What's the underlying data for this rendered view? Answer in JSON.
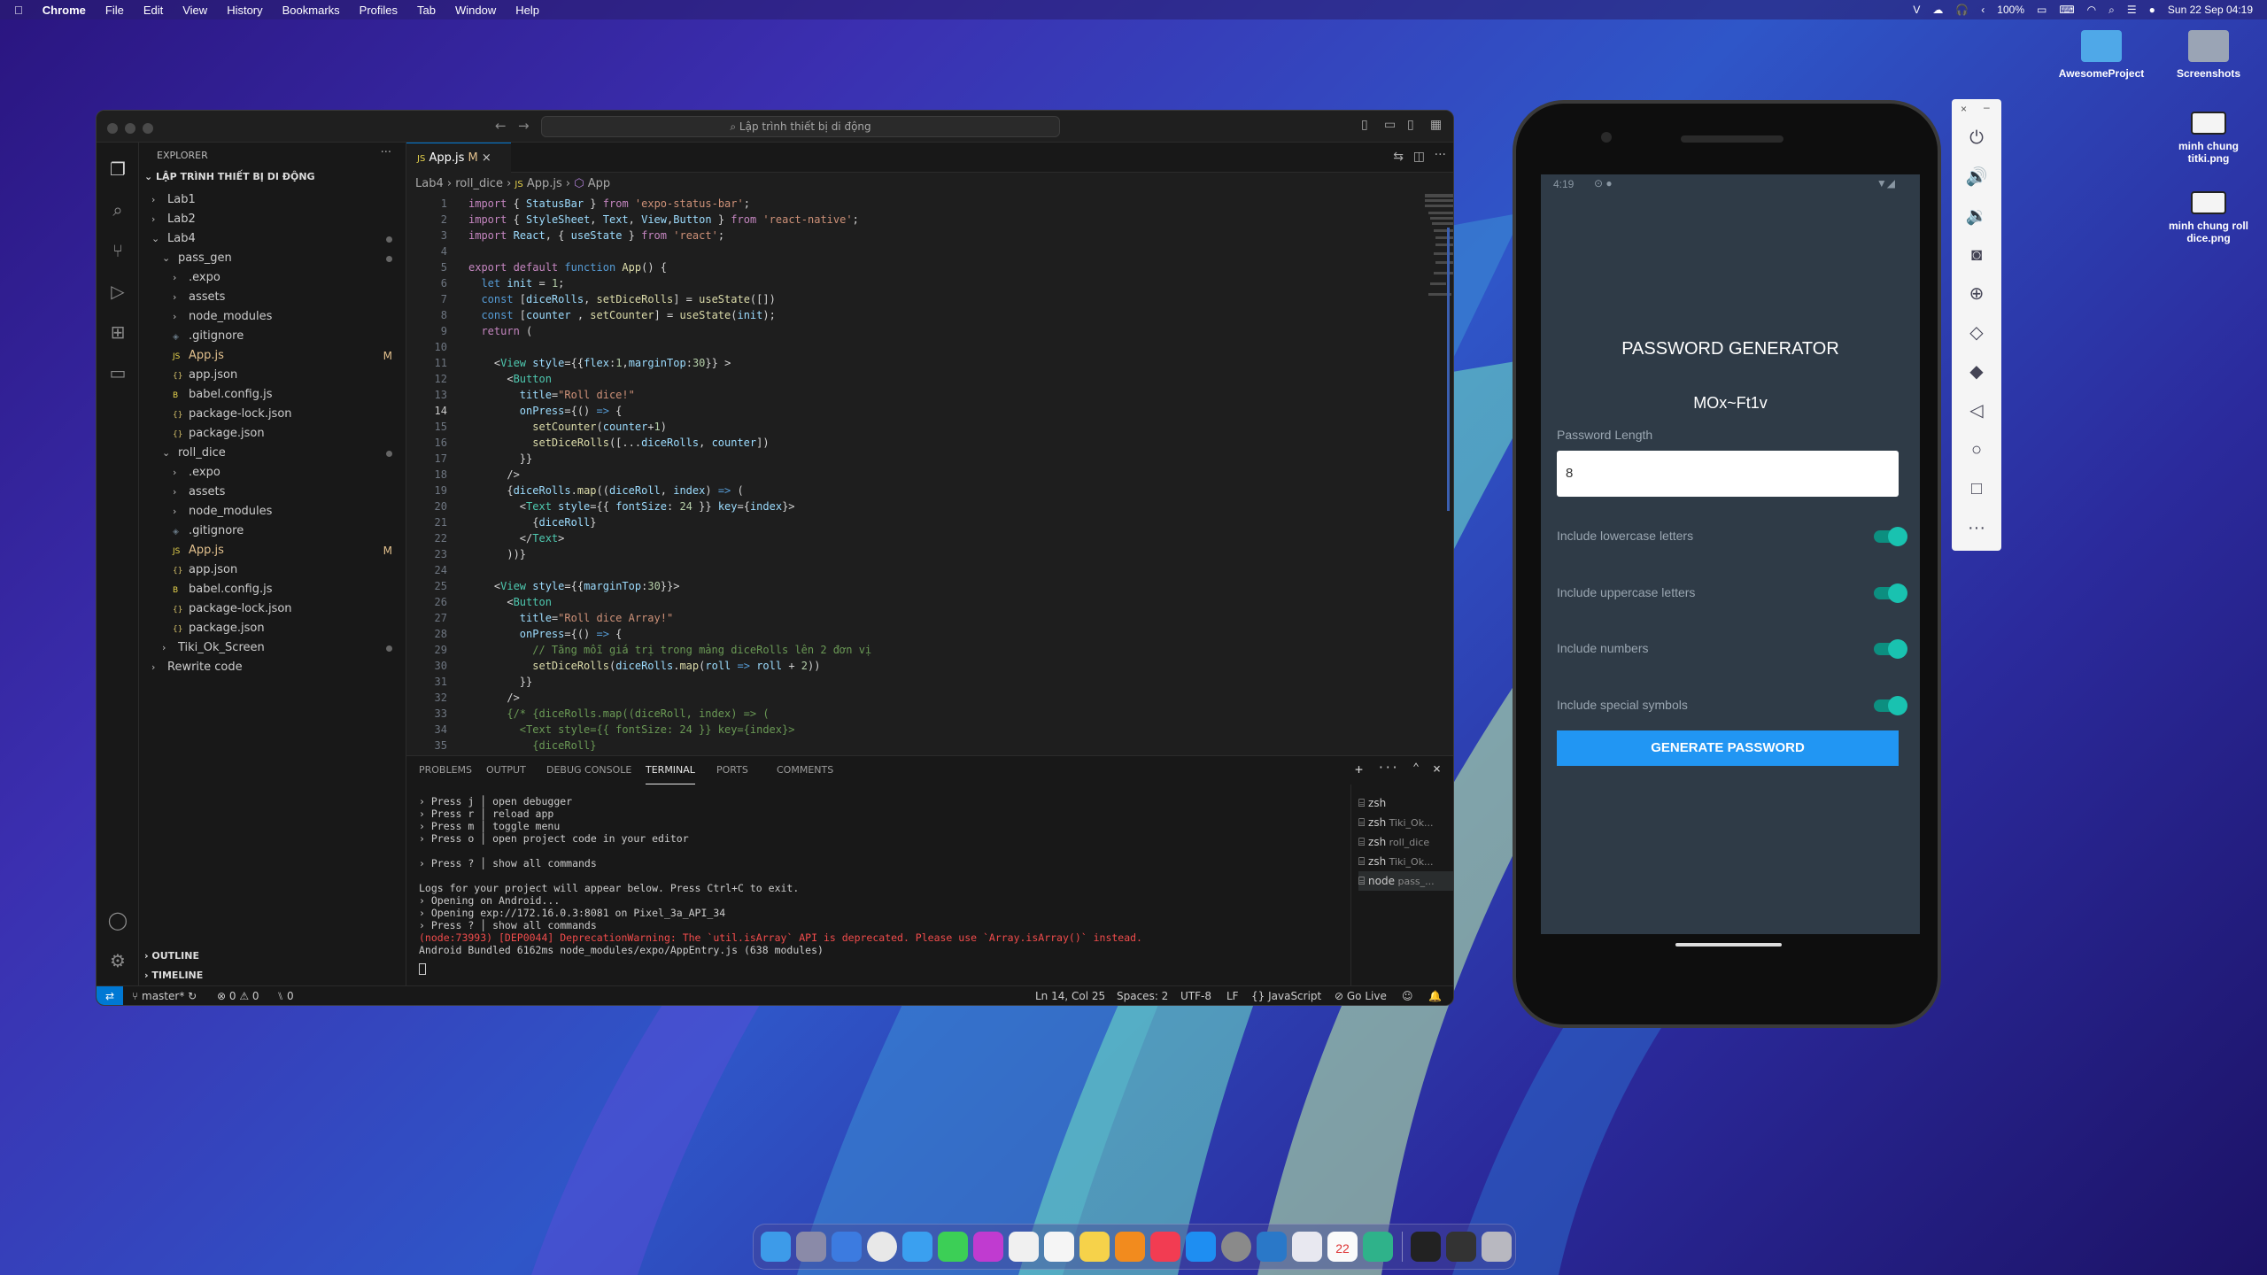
{
  "menubar": {
    "app": "Chrome",
    "items": [
      "File",
      "Edit",
      "View",
      "History",
      "Bookmarks",
      "Profiles",
      "Tab",
      "Window",
      "Help"
    ],
    "battery": "100%",
    "datetime": "Sun 22 Sep  04:19"
  },
  "desktop": {
    "icons": [
      {
        "label": "AwesomeProject"
      },
      {
        "label": "Screenshots"
      },
      {
        "label": "minh chung titki.png"
      },
      {
        "label": "minh chung roll dice.png"
      }
    ]
  },
  "vscode": {
    "search": "Lập trình thiết bị di động",
    "explorer_title": "EXPLORER",
    "workspace": "LẬP TRÌNH THIẾT BỊ DI ĐỘNG",
    "tree": [
      {
        "label": "Lab1",
        "depth": 0,
        "kind": "folder",
        "open": false
      },
      {
        "label": "Lab2",
        "depth": 0,
        "kind": "folder",
        "open": false
      },
      {
        "label": "Lab4",
        "depth": 0,
        "kind": "folder",
        "open": true,
        "dot": true
      },
      {
        "label": "pass_gen",
        "depth": 1,
        "kind": "folder",
        "open": true,
        "dot": true
      },
      {
        "label": ".expo",
        "depth": 2,
        "kind": "folder",
        "open": false
      },
      {
        "label": "assets",
        "depth": 2,
        "kind": "folder",
        "open": false
      },
      {
        "label": "node_modules",
        "depth": 2,
        "kind": "folder",
        "open": false
      },
      {
        "label": ".gitignore",
        "depth": 2,
        "kind": "file",
        "icon": "◈"
      },
      {
        "label": "App.js",
        "depth": 2,
        "kind": "file",
        "icon": "JS",
        "mod": "M"
      },
      {
        "label": "app.json",
        "depth": 2,
        "kind": "file",
        "icon": "{}"
      },
      {
        "label": "babel.config.js",
        "depth": 2,
        "kind": "file",
        "icon": "B"
      },
      {
        "label": "package-lock.json",
        "depth": 2,
        "kind": "file",
        "icon": "{}"
      },
      {
        "label": "package.json",
        "depth": 2,
        "kind": "file",
        "icon": "{}"
      },
      {
        "label": "roll_dice",
        "depth": 1,
        "kind": "folder",
        "open": true,
        "dot": true
      },
      {
        "label": ".expo",
        "depth": 2,
        "kind": "folder",
        "open": false
      },
      {
        "label": "assets",
        "depth": 2,
        "kind": "folder",
        "open": false
      },
      {
        "label": "node_modules",
        "depth": 2,
        "kind": "folder",
        "open": false
      },
      {
        "label": ".gitignore",
        "depth": 2,
        "kind": "file",
        "icon": "◈"
      },
      {
        "label": "App.js",
        "depth": 2,
        "kind": "file",
        "icon": "JS",
        "mod": "M"
      },
      {
        "label": "app.json",
        "depth": 2,
        "kind": "file",
        "icon": "{}"
      },
      {
        "label": "babel.config.js",
        "depth": 2,
        "kind": "file",
        "icon": "B"
      },
      {
        "label": "package-lock.json",
        "depth": 2,
        "kind": "file",
        "icon": "{}"
      },
      {
        "label": "package.json",
        "depth": 2,
        "kind": "file",
        "icon": "{}"
      },
      {
        "label": "Tiki_Ok_Screen",
        "depth": 1,
        "kind": "folder",
        "open": false,
        "dot": true
      },
      {
        "label": "Rewrite code",
        "depth": 0,
        "kind": "folder",
        "open": false
      }
    ],
    "outline": "OUTLINE",
    "timeline": "TIMELINE",
    "tab": {
      "label": "App.js",
      "mod": "M"
    },
    "breadcrumb": [
      "Lab4",
      "roll_dice",
      "App.js",
      "App"
    ],
    "code": [
      [
        [
          "k",
          "import"
        ],
        [
          "p",
          " { "
        ],
        [
          "v",
          "StatusBar"
        ],
        [
          "p",
          " } "
        ],
        [
          "k",
          "from"
        ],
        [
          "s",
          " 'expo-status-bar'"
        ],
        [
          "p",
          ";"
        ]
      ],
      [
        [
          "k",
          "import"
        ],
        [
          "p",
          " { "
        ],
        [
          "v",
          "StyleSheet"
        ],
        [
          "p",
          ", "
        ],
        [
          "v",
          "Text"
        ],
        [
          "p",
          ", "
        ],
        [
          "v",
          "View"
        ],
        [
          "p",
          ","
        ],
        [
          "v",
          "Button"
        ],
        [
          "p",
          " } "
        ],
        [
          "k",
          "from"
        ],
        [
          "s",
          " 'react-native'"
        ],
        [
          "p",
          ";"
        ]
      ],
      [
        [
          "k",
          "import"
        ],
        [
          "p",
          " "
        ],
        [
          "v",
          "React"
        ],
        [
          "p",
          ", { "
        ],
        [
          "v",
          "useState"
        ],
        [
          "p",
          " } "
        ],
        [
          "k",
          "from"
        ],
        [
          "s",
          " 'react'"
        ],
        [
          "p",
          ";"
        ]
      ],
      [],
      [
        [
          "k",
          "export default"
        ],
        [
          "b",
          " function"
        ],
        [
          "f",
          " App"
        ],
        [
          "p",
          "() {"
        ]
      ],
      [
        [
          "b",
          "  let"
        ],
        [
          "v",
          " init"
        ],
        [
          "p",
          " = "
        ],
        [
          "n",
          "1"
        ],
        [
          "p",
          ";"
        ]
      ],
      [
        [
          "b",
          "  const"
        ],
        [
          "p",
          " ["
        ],
        [
          "v",
          "diceRolls"
        ],
        [
          "p",
          ", "
        ],
        [
          "f",
          "setDiceRolls"
        ],
        [
          "p",
          "] = "
        ],
        [
          "f",
          "useState"
        ],
        [
          "p",
          "([])"
        ]
      ],
      [
        [
          "b",
          "  const"
        ],
        [
          "p",
          " ["
        ],
        [
          "v",
          "counter"
        ],
        [
          "p",
          " , "
        ],
        [
          "f",
          "setCounter"
        ],
        [
          "p",
          "] = "
        ],
        [
          "f",
          "useState"
        ],
        [
          "p",
          "("
        ],
        [
          "v",
          "init"
        ],
        [
          "p",
          ");"
        ]
      ],
      [
        [
          "k",
          "  return"
        ],
        [
          "p",
          " ("
        ]
      ],
      [],
      [
        [
          "p",
          "    <"
        ],
        [
          "t",
          "View"
        ],
        [
          "v",
          " style"
        ],
        [
          "p",
          "={{"
        ],
        [
          "v",
          "flex"
        ],
        [
          "p",
          ":"
        ],
        [
          "n",
          "1"
        ],
        [
          "p",
          ","
        ],
        [
          "v",
          "marginTop"
        ],
        [
          "p",
          ":"
        ],
        [
          "n",
          "30"
        ],
        [
          "p",
          "}} >"
        ]
      ],
      [
        [
          "p",
          "      <"
        ],
        [
          "t",
          "Button"
        ]
      ],
      [
        [
          "v",
          "        title"
        ],
        [
          "p",
          "="
        ],
        [
          "s",
          "\"Roll dice!\""
        ]
      ],
      [
        [
          "v",
          "        onPress"
        ],
        [
          "p",
          "={() "
        ],
        [
          "b",
          "=>"
        ],
        [
          "p",
          " {"
        ]
      ],
      [
        [
          "f",
          "          setCounter"
        ],
        [
          "p",
          "("
        ],
        [
          "v",
          "counter"
        ],
        [
          "p",
          "+"
        ],
        [
          "n",
          "1"
        ],
        [
          "p",
          ")"
        ]
      ],
      [
        [
          "f",
          "          setDiceRolls"
        ],
        [
          "p",
          "([..."
        ],
        [
          "v",
          "diceRolls"
        ],
        [
          "p",
          ", "
        ],
        [
          "v",
          "counter"
        ],
        [
          "p",
          "])"
        ]
      ],
      [
        [
          "p",
          "        }}"
        ]
      ],
      [
        [
          "p",
          "      />"
        ]
      ],
      [
        [
          "p",
          "      {"
        ],
        [
          "v",
          "diceRolls"
        ],
        [
          "p",
          "."
        ],
        [
          "f",
          "map"
        ],
        [
          "p",
          "(("
        ],
        [
          "v",
          "diceRoll"
        ],
        [
          "p",
          ", "
        ],
        [
          "v",
          "index"
        ],
        [
          "p",
          ") "
        ],
        [
          "b",
          "=>"
        ],
        [
          "p",
          " ("
        ]
      ],
      [
        [
          "p",
          "        <"
        ],
        [
          "t",
          "Text"
        ],
        [
          "v",
          " style"
        ],
        [
          "p",
          "={{ "
        ],
        [
          "v",
          "fontSize"
        ],
        [
          "p",
          ": "
        ],
        [
          "n",
          "24"
        ],
        [
          "p",
          " }} "
        ],
        [
          "v",
          "key"
        ],
        [
          "p",
          "={"
        ],
        [
          "v",
          "index"
        ],
        [
          "p",
          "}>"
        ]
      ],
      [
        [
          "p",
          "          {"
        ],
        [
          "v",
          "diceRoll"
        ],
        [
          "p",
          "}"
        ]
      ],
      [
        [
          "p",
          "        </"
        ],
        [
          "t",
          "Text"
        ],
        [
          "p",
          ">"
        ]
      ],
      [
        [
          "p",
          "      ))}"
        ]
      ],
      [],
      [
        [
          "p",
          "    <"
        ],
        [
          "t",
          "View"
        ],
        [
          "v",
          " style"
        ],
        [
          "p",
          "={{"
        ],
        [
          "v",
          "marginTop"
        ],
        [
          "p",
          ":"
        ],
        [
          "n",
          "30"
        ],
        [
          "p",
          "}}>"
        ]
      ],
      [
        [
          "p",
          "      <"
        ],
        [
          "t",
          "Button"
        ]
      ],
      [
        [
          "v",
          "        title"
        ],
        [
          "p",
          "="
        ],
        [
          "s",
          "\"Roll dice Array!\""
        ]
      ],
      [
        [
          "v",
          "        onPress"
        ],
        [
          "p",
          "={() "
        ],
        [
          "b",
          "=>"
        ],
        [
          "p",
          " {"
        ]
      ],
      [
        [
          "c",
          "          // Tăng mỗi giá trị trong mảng diceRolls lên 2 đơn vị"
        ]
      ],
      [
        [
          "f",
          "          setDiceRolls"
        ],
        [
          "p",
          "("
        ],
        [
          "v",
          "diceRolls"
        ],
        [
          "p",
          "."
        ],
        [
          "f",
          "map"
        ],
        [
          "p",
          "("
        ],
        [
          "v",
          "roll"
        ],
        [
          "b",
          " =>"
        ],
        [
          "v",
          " roll"
        ],
        [
          "p",
          " + "
        ],
        [
          "n",
          "2"
        ],
        [
          "p",
          "))"
        ]
      ],
      [
        [
          "p",
          "        }}"
        ]
      ],
      [
        [
          "p",
          "      />"
        ]
      ],
      [
        [
          "c",
          "      {/* {diceRolls.map((diceRoll, index) => ("
        ]
      ],
      [
        [
          "c",
          "        <Text style={{ fontSize: 24 }} key={index}>"
        ]
      ],
      [
        [
          "c",
          "          {diceRoll}"
        ]
      ],
      [
        [
          "c",
          "        </Text>"
        ]
      ]
    ],
    "panel_tabs": [
      "PROBLEMS",
      "OUTPUT",
      "DEBUG CONSOLE",
      "TERMINAL",
      "PORTS",
      "COMMENTS"
    ],
    "terminal": [
      {
        "text": "› Press j │ open debugger",
        "color": "#cccccc",
        "bold": false
      },
      {
        "text": "› Press r │ reload app",
        "color": "#cccccc",
        "bold": false
      },
      {
        "text": "› Press m │ toggle menu",
        "color": "#cccccc",
        "bold": false
      },
      {
        "text": "› Press o │ open project code in your editor",
        "color": "#cccccc",
        "bold": false
      },
      {
        "text": "",
        "color": "#cccccc",
        "bold": false
      },
      {
        "text": "› Press ? │ show all commands",
        "color": "#cccccc",
        "bold": false
      },
      {
        "text": "",
        "color": "#cccccc",
        "bold": false
      },
      {
        "text": "Logs for your project will appear below. Press Ctrl+C to exit.",
        "color": "#cccccc",
        "bold": false
      },
      {
        "text": "› Opening on Android...",
        "color": "#cccccc",
        "bold": false
      },
      {
        "text": "› Opening exp://172.16.0.3:8081 on Pixel_3a_API_34",
        "color": "#cccccc",
        "bold": false
      },
      {
        "text": "› Press ? │ show all commands",
        "color": "#cccccc",
        "bold": false
      },
      {
        "text": "(node:73993) [DEP0044] DeprecationWarning: The `util.isArray` API is deprecated. Please use `Array.isArray()` instead.",
        "color": "#f14c4c",
        "bold": false
      },
      {
        "text": "Android Bundled 6162ms node_modules/expo/AppEntry.js (638 modules)",
        "color": "#cccccc",
        "bold": false
      }
    ],
    "terminals": [
      {
        "label": "zsh",
        "sub": ""
      },
      {
        "label": "zsh",
        "sub": "Tiki_Ok..."
      },
      {
        "label": "zsh",
        "sub": "roll_dice"
      },
      {
        "label": "zsh",
        "sub": "Tiki_Ok..."
      },
      {
        "label": "node",
        "sub": "pass_..."
      }
    ],
    "status": {
      "branch": "master*",
      "errors": "0",
      "warnings": "0",
      "ports": "0",
      "cursor": "Ln 14, Col 25",
      "spaces": "Spaces: 2",
      "encoding": "UTF-8",
      "eol": "LF",
      "lang": "JavaScript",
      "golive": "Go Live"
    }
  },
  "phone": {
    "time": "4:19",
    "title": "PASSWORD GENERATOR",
    "password": "MOx~Ft1v",
    "length_label": "Password Length",
    "length_value": "8",
    "options": [
      {
        "label": "Include lowercase letters",
        "on": true
      },
      {
        "label": "Include uppercase letters",
        "on": true
      },
      {
        "label": "Include numbers",
        "on": true
      },
      {
        "label": "Include special symbols",
        "on": true
      }
    ],
    "button": "GENERATE PASSWORD"
  },
  "dock": {
    "date_badge": "22"
  }
}
